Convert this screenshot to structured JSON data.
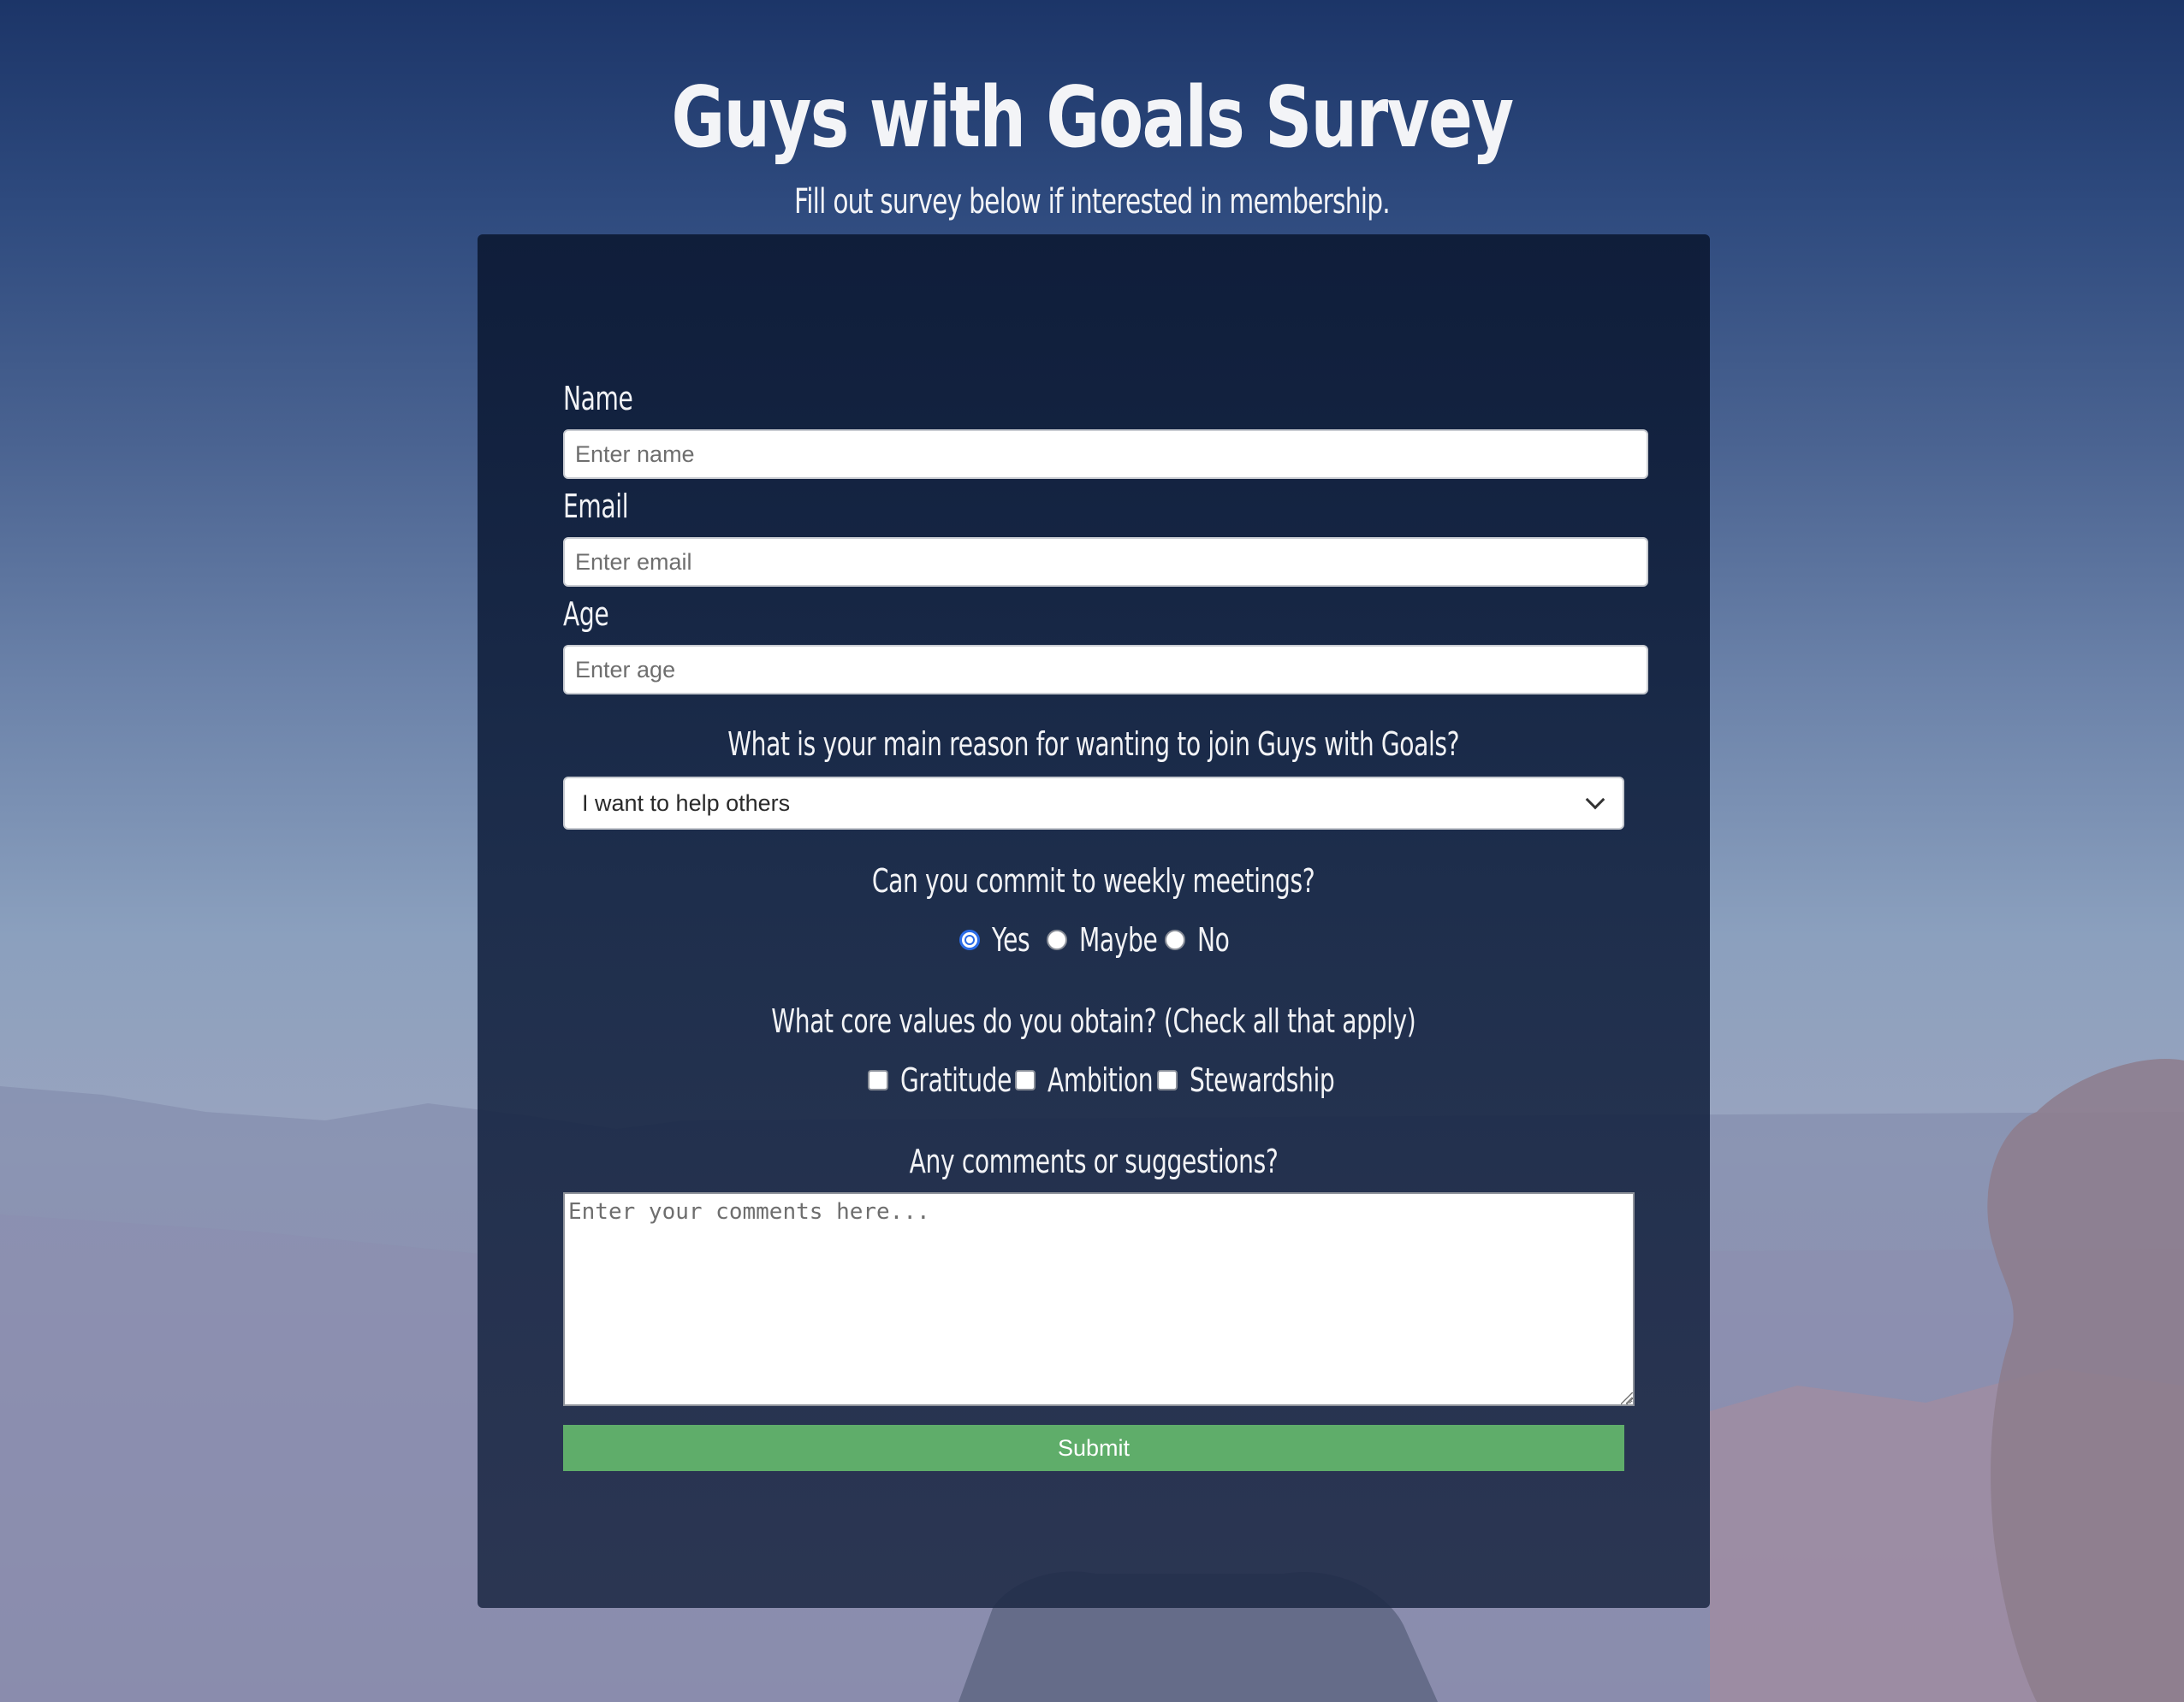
{
  "page": {
    "title": "Guys with Goals Survey",
    "subtitle": "Fill out survey below if interested in membership."
  },
  "form": {
    "name": {
      "label": "Name",
      "placeholder": "Enter name"
    },
    "email": {
      "label": "Email",
      "placeholder": "Enter email"
    },
    "age": {
      "label": "Age",
      "placeholder": "Enter age"
    },
    "reason": {
      "question": "What is your main reason for wanting to join Guys with Goals?",
      "selected": "I want to help others"
    },
    "meetings": {
      "question": "Can you commit to weekly meetings?",
      "options": [
        "Yes",
        "Maybe",
        "No"
      ],
      "selected": "Yes"
    },
    "values": {
      "question": "What core values do you obtain? (Check all that apply)",
      "options": [
        "Gratitude",
        "Ambition",
        "Stewardship"
      ]
    },
    "comments": {
      "question": "Any comments or suggestions?",
      "placeholder": "Enter your comments here..."
    },
    "submit_label": "Submit"
  },
  "colors": {
    "submit": "#5fad6a",
    "panel": "#0e1c38",
    "radio_accent": "#2a6ce8"
  }
}
